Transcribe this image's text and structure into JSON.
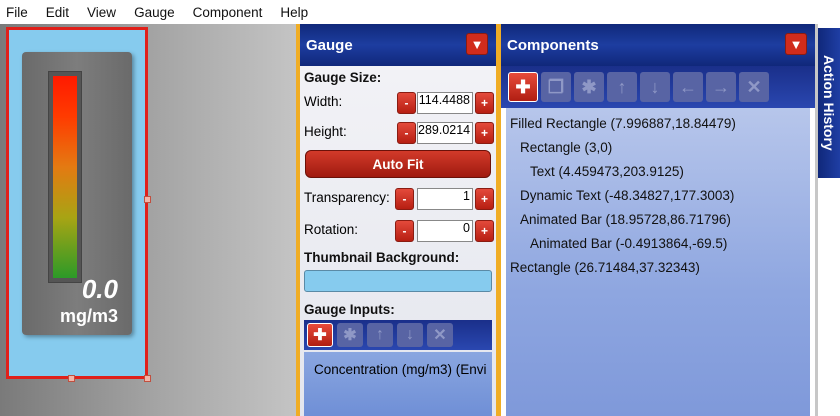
{
  "menu": [
    "File",
    "Edit",
    "View",
    "Gauge",
    "Component",
    "Help"
  ],
  "canvas": {
    "gauge_value": "0.0",
    "gauge_unit": "mg/m3",
    "bar_fraction": 1.0
  },
  "gauge_panel": {
    "title": "Gauge",
    "pin_icon": "pin-icon",
    "size_title": "Gauge Size:",
    "width_label": "Width:",
    "width_value": "114.4488",
    "height_label": "Height:",
    "height_value": "289.0214",
    "minus": "-",
    "plus": "+",
    "autofit_label": "Auto Fit",
    "transparency_label": "Transparency:",
    "transparency_value": "1",
    "rotation_label": "Rotation:",
    "rotation_value": "0",
    "thumb_title": "Thumbnail Background:",
    "thumb_color": "#86cbee",
    "inputs_title": "Gauge Inputs:",
    "inputs": [
      "Concentration (mg/m3) (Envi"
    ]
  },
  "components_panel": {
    "title": "Components",
    "items": [
      {
        "label": "Filled Rectangle (7.996887,18.84479)",
        "indent": 0
      },
      {
        "label": "Rectangle (3,0)",
        "indent": 1
      },
      {
        "label": "Text (4.459473,203.9125)",
        "indent": 2
      },
      {
        "label": "Dynamic Text (-48.34827,177.3003)",
        "indent": 1
      },
      {
        "label": "Animated Bar (18.95728,86.71796)",
        "indent": 1
      },
      {
        "label": "Animated Bar (-0.4913864,-69.5)",
        "indent": 2
      },
      {
        "label": "Rectangle (26.71484,37.32343)",
        "indent": 0
      }
    ]
  },
  "history_tab": "Action History",
  "colors": {
    "accent_red": "#d12c1c",
    "header_blue": "#10287a",
    "separator_orange": "#f0ad25",
    "selection_red": "#e0201a"
  }
}
